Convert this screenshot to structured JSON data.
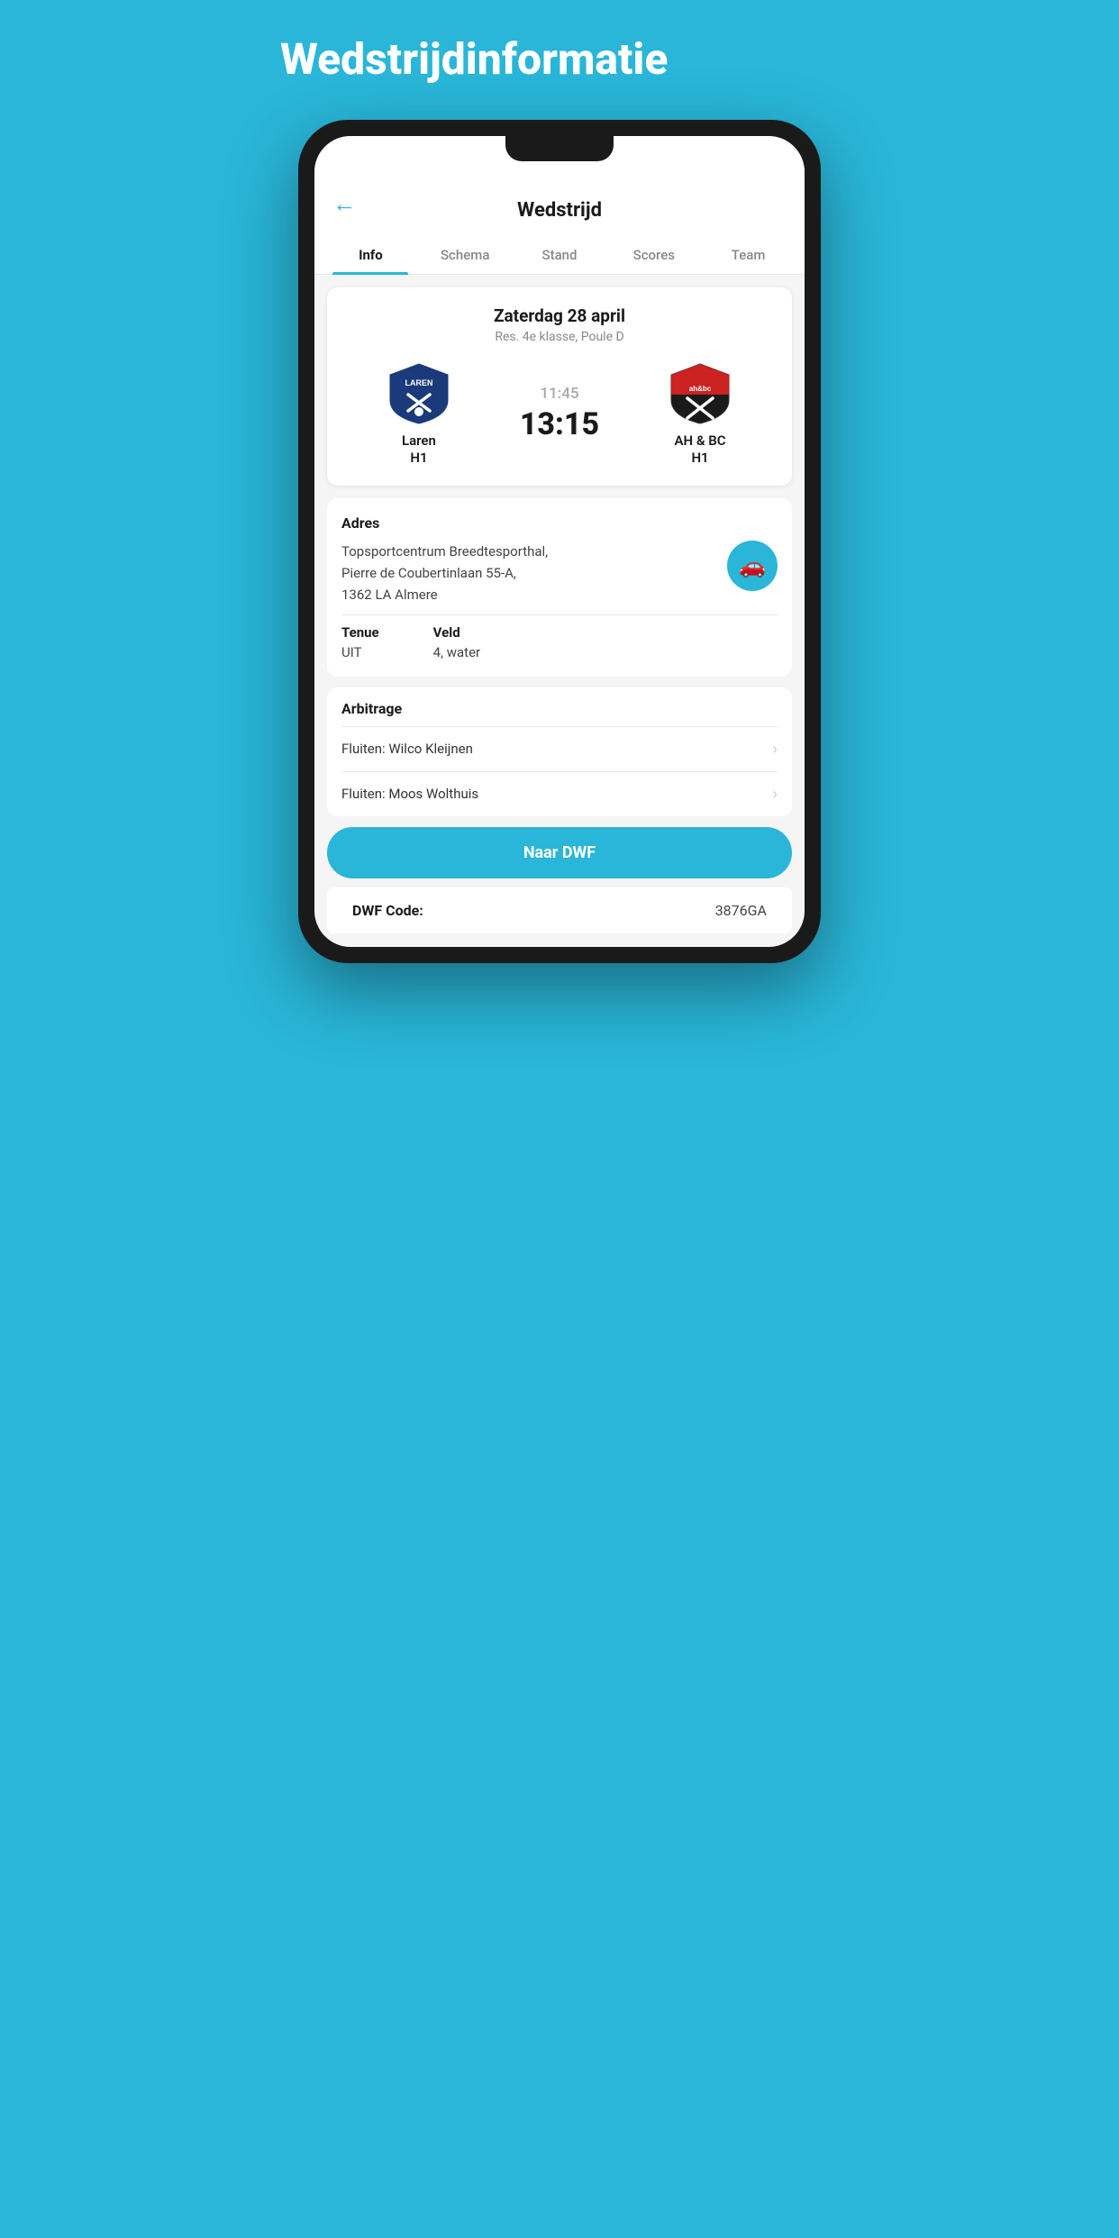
{
  "page": {
    "title": "Wedstrijdinformatie",
    "header": {
      "back_label": "←",
      "title": "Wedstrijd"
    },
    "tabs": [
      {
        "id": "info",
        "label": "Info",
        "active": true
      },
      {
        "id": "schema",
        "label": "Schema",
        "active": false
      },
      {
        "id": "stand",
        "label": "Stand",
        "active": false
      },
      {
        "id": "scores",
        "label": "Scores",
        "active": false
      },
      {
        "id": "team",
        "label": "Team",
        "active": false
      }
    ],
    "match": {
      "date": "Zaterdag 28 april",
      "league": "Res. 4e klasse, Poule D",
      "home_team": "Laren",
      "home_team_sub": "H1",
      "away_team": "AH & BC",
      "away_team_sub": "H1",
      "kickoff_time": "11:45",
      "score": "13:15"
    },
    "address": {
      "label": "Adres",
      "text_line1": "Topsportcentrum Breedtesporthal,",
      "text_line2": "Pierre de Coubertinlaan 55-A,",
      "text_line3": "1362 LA Almere"
    },
    "tenue": {
      "label": "Tenue",
      "value": "UIT"
    },
    "veld": {
      "label": "Veld",
      "value": "4, water"
    },
    "arbitrage": {
      "label": "Arbitrage",
      "items": [
        {
          "label": "Fluiten: Wilco Kleijnen"
        },
        {
          "label": "Fluiten: Moos Wolthuis"
        }
      ]
    },
    "dwf_button": {
      "label": "Naar DWF"
    },
    "dwf_code": {
      "label": "DWF Code:",
      "value": "3876GA"
    },
    "colors": {
      "accent": "#29b6d8",
      "background": "#29b6d8"
    }
  }
}
